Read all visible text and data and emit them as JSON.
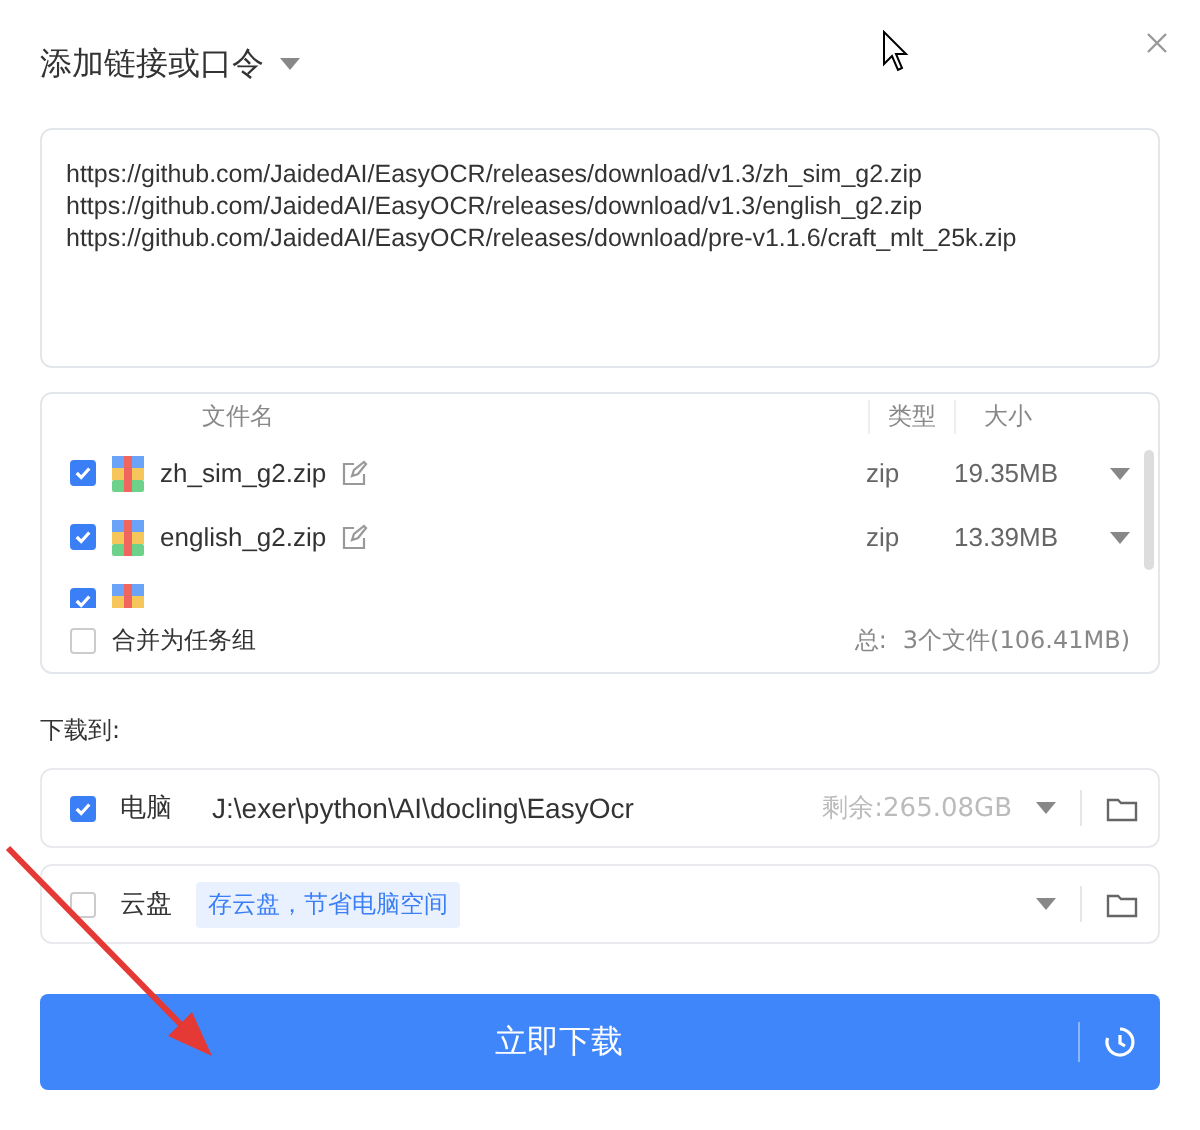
{
  "title": "添加链接或口令",
  "links": [
    "https://github.com/JaidedAI/EasyOCR/releases/download/v1.3/zh_sim_g2.zip",
    "https://github.com/JaidedAI/EasyOCR/releases/download/v1.3/english_g2.zip",
    "https://github.com/JaidedAI/EasyOCR/releases/download/pre-v1.1.6/craft_mlt_25k.zip"
  ],
  "file_table": {
    "columns": [
      "文件名",
      "类型",
      "大小"
    ],
    "rows": [
      {
        "checked": true,
        "name": "zh_sim_g2.zip",
        "type": "zip",
        "size": "19.35MB"
      },
      {
        "checked": true,
        "name": "english_g2.zip",
        "type": "zip",
        "size": "13.39MB"
      },
      {
        "checked": true
      }
    ],
    "merge_group": {
      "label": "合并为任务组",
      "checked": false
    },
    "total_label": "总:",
    "total": "3个文件(106.41MB)"
  },
  "download_to": {
    "label": "下载到:",
    "targets": [
      {
        "kind": "local",
        "checked": true,
        "label": "电脑",
        "path": "J:\\exer\\python\\AI\\docling\\EasyOcr",
        "free": "剩余:265.08GB"
      },
      {
        "kind": "cloud",
        "checked": false,
        "label": "云盘",
        "hint": "存云盘，节省电脑空间"
      }
    ]
  },
  "download_button": "立即下载"
}
